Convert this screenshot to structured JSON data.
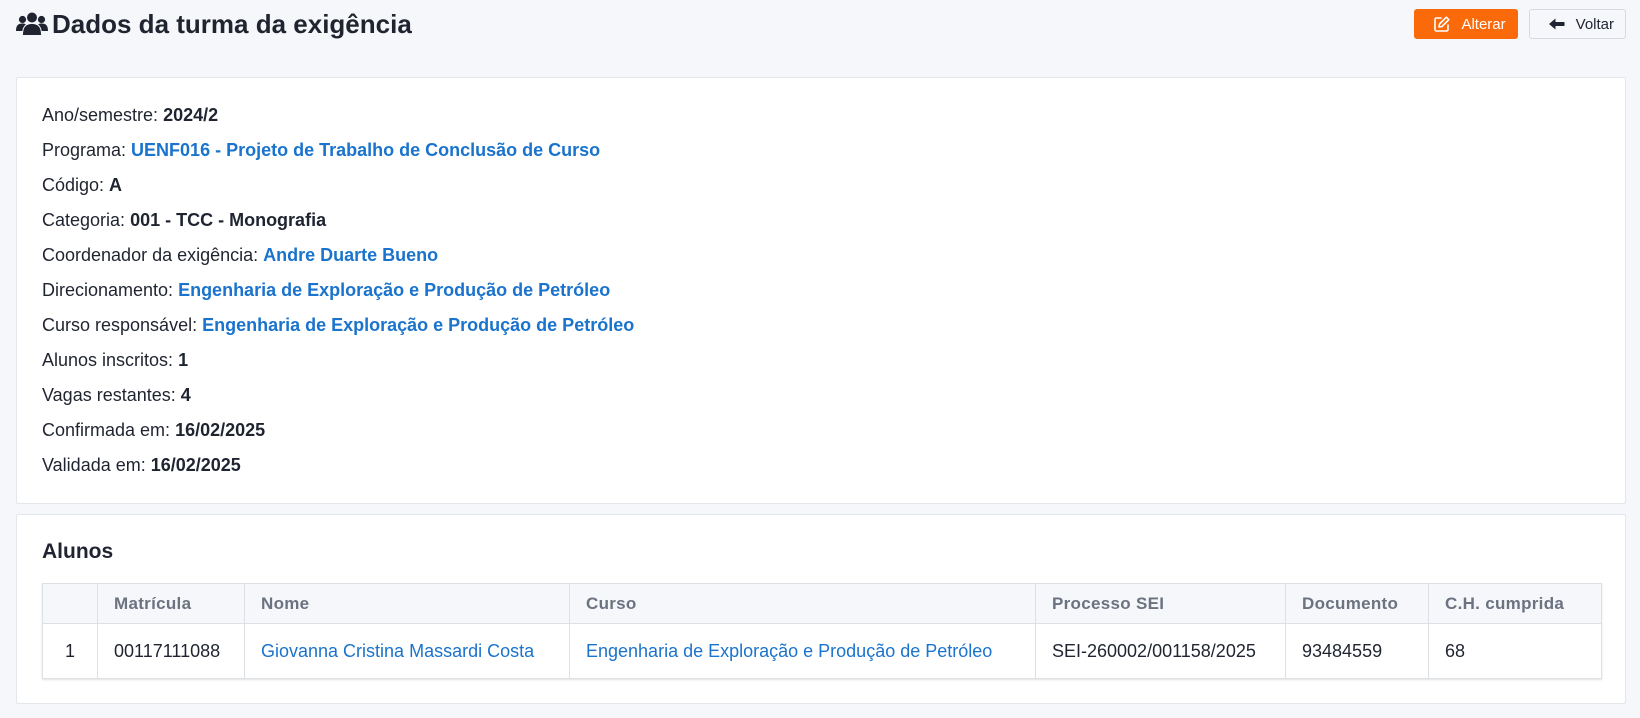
{
  "header": {
    "title": "Dados da turma da exigência",
    "alterar_label": "Alterar",
    "voltar_label": "Voltar"
  },
  "details": [
    {
      "label": "Ano/semestre:",
      "value": "2024/2",
      "link": false
    },
    {
      "label": "Programa:",
      "value": "UENF016 - Projeto de Trabalho de Conclusão de Curso",
      "link": true
    },
    {
      "label": "Código:",
      "value": "A",
      "link": false
    },
    {
      "label": "Categoria:",
      "value": "001 - TCC - Monografia",
      "link": false
    },
    {
      "label": "Coordenador da exigência:",
      "value": "Andre Duarte Bueno",
      "link": true
    },
    {
      "label": "Direcionamento:",
      "value": "Engenharia de Exploração e Produção de Petróleo",
      "link": true
    },
    {
      "label": "Curso responsável:",
      "value": "Engenharia de Exploração e Produção de Petróleo",
      "link": true
    },
    {
      "label": "Alunos inscritos:",
      "value": "1",
      "link": false
    },
    {
      "label": "Vagas restantes:",
      "value": "4",
      "link": false
    },
    {
      "label": "Confirmada em:",
      "value": "16/02/2025",
      "link": false
    },
    {
      "label": "Validada em:",
      "value": "16/02/2025",
      "link": false
    }
  ],
  "students": {
    "title": "Alunos",
    "columns": [
      "",
      "Matrícula",
      "Nome",
      "Curso",
      "Processo SEI",
      "Documento",
      "C.H. cumprida"
    ],
    "rows": [
      [
        "1",
        "00117111088",
        "Giovanna Cristina Massardi Costa",
        "Engenharia de Exploração e Produção de Petróleo",
        "SEI-260002/001158/2025",
        "93484559",
        "68"
      ]
    ]
  },
  "colors": {
    "accent": "#fa6a0a",
    "link": "#1a73cc"
  }
}
